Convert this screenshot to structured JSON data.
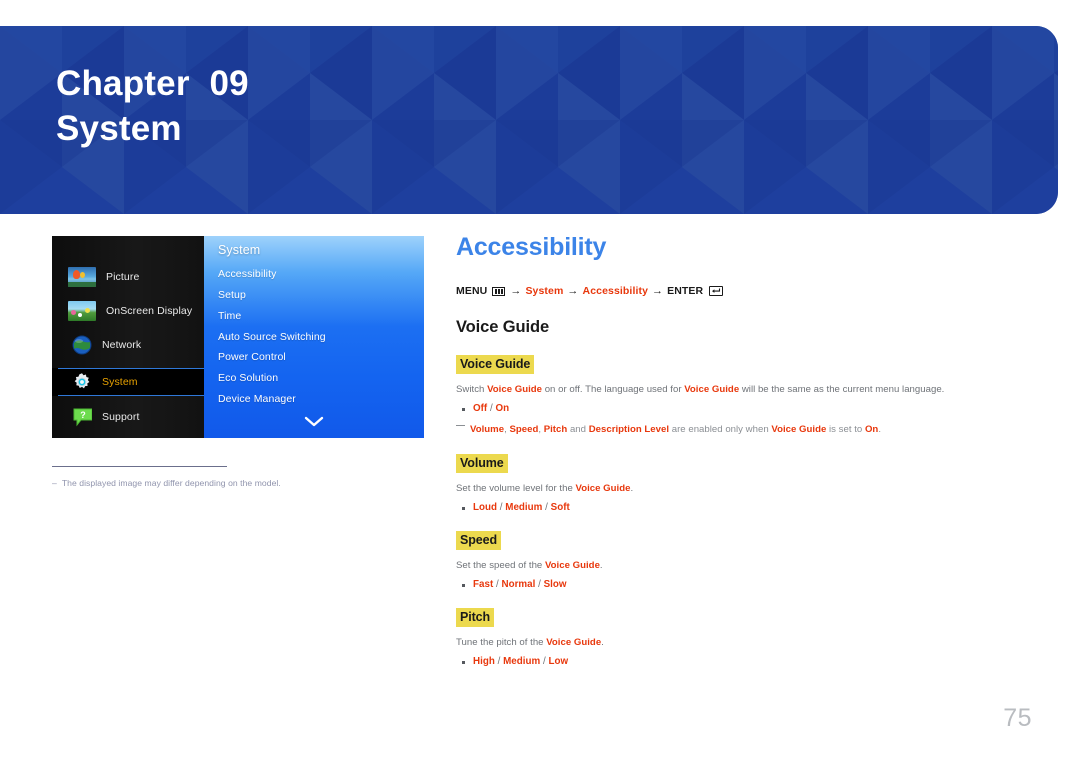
{
  "banner": {
    "chapter_label": "Chapter  09",
    "chapter_title": "System",
    "bg_color": "#1e3f9e"
  },
  "osd_menu": {
    "categories": [
      {
        "label": "Picture",
        "icon": "picture-icon",
        "active": false
      },
      {
        "label": "OnScreen Display",
        "icon": "onscreen-display-icon",
        "active": false
      },
      {
        "label": "Network",
        "icon": "globe-icon",
        "active": false
      },
      {
        "label": "System",
        "icon": "gear-icon",
        "active": true
      },
      {
        "label": "Support",
        "icon": "help-bubble-icon",
        "active": false
      }
    ],
    "panel_header": "System",
    "items": [
      "Accessibility",
      "Setup",
      "Time",
      "Auto Source Switching",
      "Power Control",
      "Eco Solution",
      "Device Manager"
    ],
    "scroll_icon": "chevron-down-icon",
    "footnote_dash": "–",
    "footnote": "The displayed image may differ depending on the model."
  },
  "content": {
    "title": "Accessibility",
    "breadcrumb": {
      "menu_label": "MENU",
      "menu_icon": "menu-icon",
      "arrow": "→",
      "crumb1": "System",
      "crumb2": "Accessibility",
      "enter_label": "ENTER",
      "enter_icon": "enter-icon"
    },
    "heading": "Voice Guide",
    "sections": [
      {
        "title": "Voice Guide",
        "desc_parts": [
          {
            "t": "Switch ",
            "b": false
          },
          {
            "t": "Voice Guide",
            "b": true
          },
          {
            "t": " on or off. The language used for ",
            "b": false
          },
          {
            "t": "Voice Guide",
            "b": true
          },
          {
            "t": " will be the same as the current menu language.",
            "b": false
          }
        ],
        "options": [
          "Off",
          "On"
        ],
        "note_parts": [
          {
            "t": "Volume",
            "b": true
          },
          {
            "t": ", ",
            "b": false
          },
          {
            "t": "Speed",
            "b": true
          },
          {
            "t": ", ",
            "b": false
          },
          {
            "t": "Pitch",
            "b": true
          },
          {
            "t": " and ",
            "b": false
          },
          {
            "t": "Description Level",
            "b": true
          },
          {
            "t": " are enabled only when ",
            "b": false
          },
          {
            "t": "Voice Guide",
            "b": true
          },
          {
            "t": " is set to ",
            "b": false
          },
          {
            "t": "On",
            "b": true
          },
          {
            "t": ".",
            "b": false
          }
        ]
      },
      {
        "title": "Volume",
        "desc_parts": [
          {
            "t": "Set the volume level for the ",
            "b": false
          },
          {
            "t": "Voice Guide",
            "b": true
          },
          {
            "t": ".",
            "b": false
          }
        ],
        "options": [
          "Loud",
          "Medium",
          "Soft"
        ],
        "note_parts": []
      },
      {
        "title": "Speed",
        "desc_parts": [
          {
            "t": "Set the speed of the ",
            "b": false
          },
          {
            "t": "Voice Guide",
            "b": true
          },
          {
            "t": ".",
            "b": false
          }
        ],
        "options": [
          "Fast",
          "Normal",
          "Slow"
        ],
        "note_parts": []
      },
      {
        "title": "Pitch",
        "desc_parts": [
          {
            "t": "Tune the pitch of the ",
            "b": false
          },
          {
            "t": "Voice Guide",
            "b": true
          },
          {
            "t": ".",
            "b": false
          }
        ],
        "options": [
          "High",
          "Medium",
          "Low"
        ],
        "note_parts": []
      }
    ]
  },
  "page_number": "75",
  "colors": {
    "accent_blue": "#3c84e8",
    "highlight_yellow": "#ecd94e",
    "term_red": "#e8380d",
    "body_gray": "#6f7378",
    "banner_blue": "#1e3f9e",
    "osd_menu_blue": "#1464f0"
  }
}
